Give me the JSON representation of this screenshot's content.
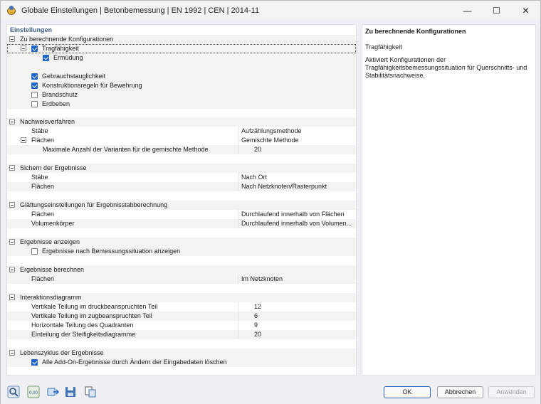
{
  "window": {
    "title": "Globale Einstellungen | Betonbemessung | EN 1992 | CEN | 2014-11",
    "minimize_symbol": "—",
    "maximize_symbol": "☐",
    "close_symbol": "✕"
  },
  "left_panel": {
    "header": "Einstellungen",
    "sections": {
      "konfig": {
        "title": "Zu berechnende Konfigurationen",
        "tragfaehigkeit": "Tragfähigkeit",
        "ermuedung": "Ermüdung",
        "gebrauch": "Gebrauchstauglichkeit",
        "konstruktion": "Konstruktionsregeln für Bewehrung",
        "brandschutz": "Brandschutz",
        "erdbeben": "Erdbeben"
      },
      "nachweis": {
        "title": "Nachweisverfahren",
        "staebe_label": "Stäbe",
        "staebe_value": "Aufzählungsmethode",
        "flaechen_label": "Flächen",
        "flaechen_value": "Gemischte Methode",
        "max_label": "Maximale Anzahl der Varianten für die gemischte Methode",
        "max_value": "20"
      },
      "sichern": {
        "title": "Sichern der Ergebnisse",
        "staebe_label": "Stäbe",
        "staebe_value": "Nach Ort",
        "flaechen_label": "Flächen",
        "flaechen_value": "Nach Netzknoten/Rasterpunkt"
      },
      "glaettung": {
        "title": "Glättungseinstellungen für Ergebnisstabberechnung",
        "flaechen_label": "Flächen",
        "flaechen_value": "Durchlaufend innerhalb von Flächen",
        "volumen_label": "Volumenkörper",
        "volumen_value": "Durchlaufend innerhalb von Volumen..."
      },
      "anzeigen": {
        "title": "Ergebnisse anzeigen",
        "item": "Ergebnisse nach Bemessungssituation anzeigen"
      },
      "berechnen": {
        "title": "Ergebnisse berechnen",
        "flaechen_label": "Flächen",
        "flaechen_value": "Im Netzknoten"
      },
      "interaktion": {
        "title": "Interaktionsdiagramm",
        "v_druck_label": "Vertikale Teilung im druckbeanspruchten Teil",
        "v_druck_value": "12",
        "v_zug_label": "Vertikale Teilung im zugbeanspruchten Teil",
        "v_zug_value": "6",
        "h_label": "Horizontale Teilung des Quadranten",
        "h_value": "9",
        "steif_label": "Einteilung der Steifigkeitsdiagramme",
        "steif_value": "20"
      },
      "lebenszyklus": {
        "title": "Lebenszyklus der Ergebnisse",
        "item": "Alle Add-On-Ergebnisse durch Ändern der Eingabedaten löschen"
      }
    }
  },
  "right_panel": {
    "title": "Zu berechnende Konfigurationen",
    "subtitle": "Tragfähigkeit",
    "description": "Aktiviert Konfigurationen der Tragfähigkeitsbemessungssituation für Querschnitts- und Stabilitätsnachweise."
  },
  "buttons": {
    "ok": "OK",
    "cancel": "Abbrechen",
    "apply": "Anwenden"
  },
  "toolbar_icons": [
    "help-icon",
    "units-icon",
    "import-export-icon",
    "save-defaults-icon",
    "copy-settings-icon"
  ],
  "units_icon_text": "0.00",
  "accent_color": "#1f64c8"
}
